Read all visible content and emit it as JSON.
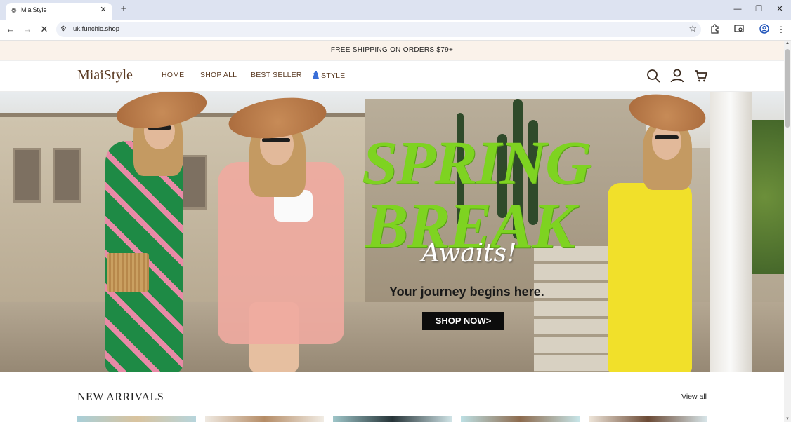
{
  "browser": {
    "tab_title": "MiaiStyle",
    "favicon": "store-favicon",
    "url": "uk.funchic.shop",
    "icons": {
      "back": "arrow-left-icon",
      "forward": "arrow-right-icon",
      "reload": "close-icon",
      "site_info": "tune-icon",
      "bookmark": "star-icon",
      "extensions": "puzzle-icon",
      "cast": "cast-search-icon",
      "profile": "account-circle-icon",
      "menu": "kebab-menu-icon"
    },
    "window_controls": [
      "minimize",
      "restore",
      "close"
    ]
  },
  "page": {
    "announcement": "FREE SHIPPING ON ORDERS $79+",
    "logo": "MiaiStyle",
    "nav": [
      {
        "label": "HOME"
      },
      {
        "label": "SHOP ALL"
      },
      {
        "label": "BEST SELLER"
      },
      {
        "label": "STYLE",
        "icon": "dress-icon"
      }
    ],
    "header_icons": [
      "search-icon",
      "user-icon",
      "cart-icon"
    ],
    "hero": {
      "headline_1": "SPRING",
      "headline_2": "BREAK",
      "script": "Awaits!",
      "tagline": "Your journey begins here.",
      "cta": "SHOP NOW>"
    },
    "section": {
      "title": "NEW ARRIVALS",
      "link": "View all"
    },
    "colors": {
      "announcement_bg": "#faf2ea",
      "brand_text": "#5a3a22",
      "headline_green": "#7ed321",
      "cta_bg": "#0c0c0c",
      "nav_icon_blue": "#3a6fd8"
    }
  }
}
